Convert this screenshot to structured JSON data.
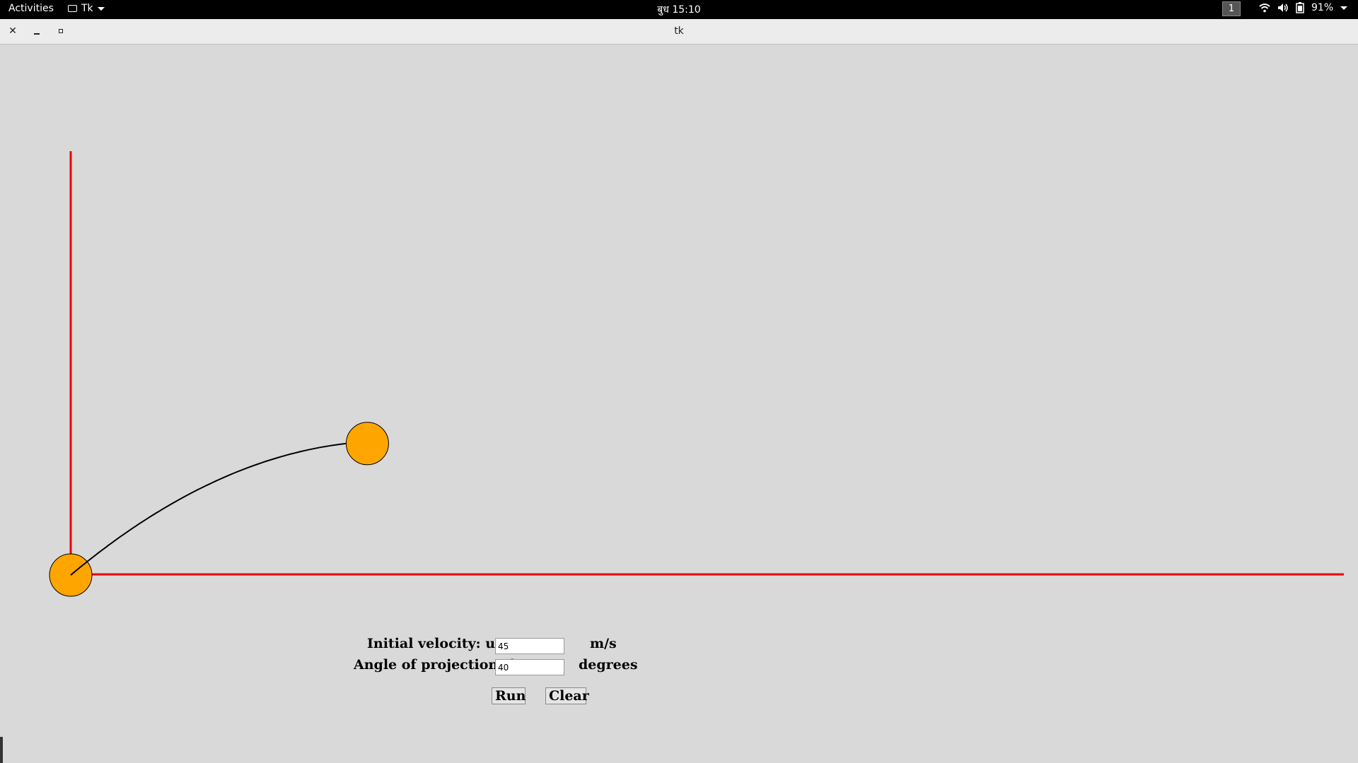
{
  "topbar": {
    "activities": "Activities",
    "app_name": "Tk",
    "clock": "बुध 15:10",
    "workspace": "1",
    "battery": "91%"
  },
  "window": {
    "title": "tk",
    "close_icon": "close-icon",
    "minimize_icon": "minimize-icon",
    "maximize_icon": "maximize-icon"
  },
  "form": {
    "velocity_label": "Initial velocity: u=",
    "velocity_value": "45",
    "velocity_unit": "m/s",
    "angle_label": "Angle of projection: θ=",
    "angle_value": "40",
    "angle_unit": "degrees",
    "run_label": "Run",
    "clear_label": "Clear"
  },
  "colors": {
    "axis": "#ee0000",
    "ball_fill": "#ffa500",
    "ball_stroke": "#000000",
    "trajectory": "#000000",
    "background": "#d9d9d9"
  },
  "simulation": {
    "velocity_mps": 45,
    "angle_deg": 40,
    "progress_fraction": 0.43
  }
}
